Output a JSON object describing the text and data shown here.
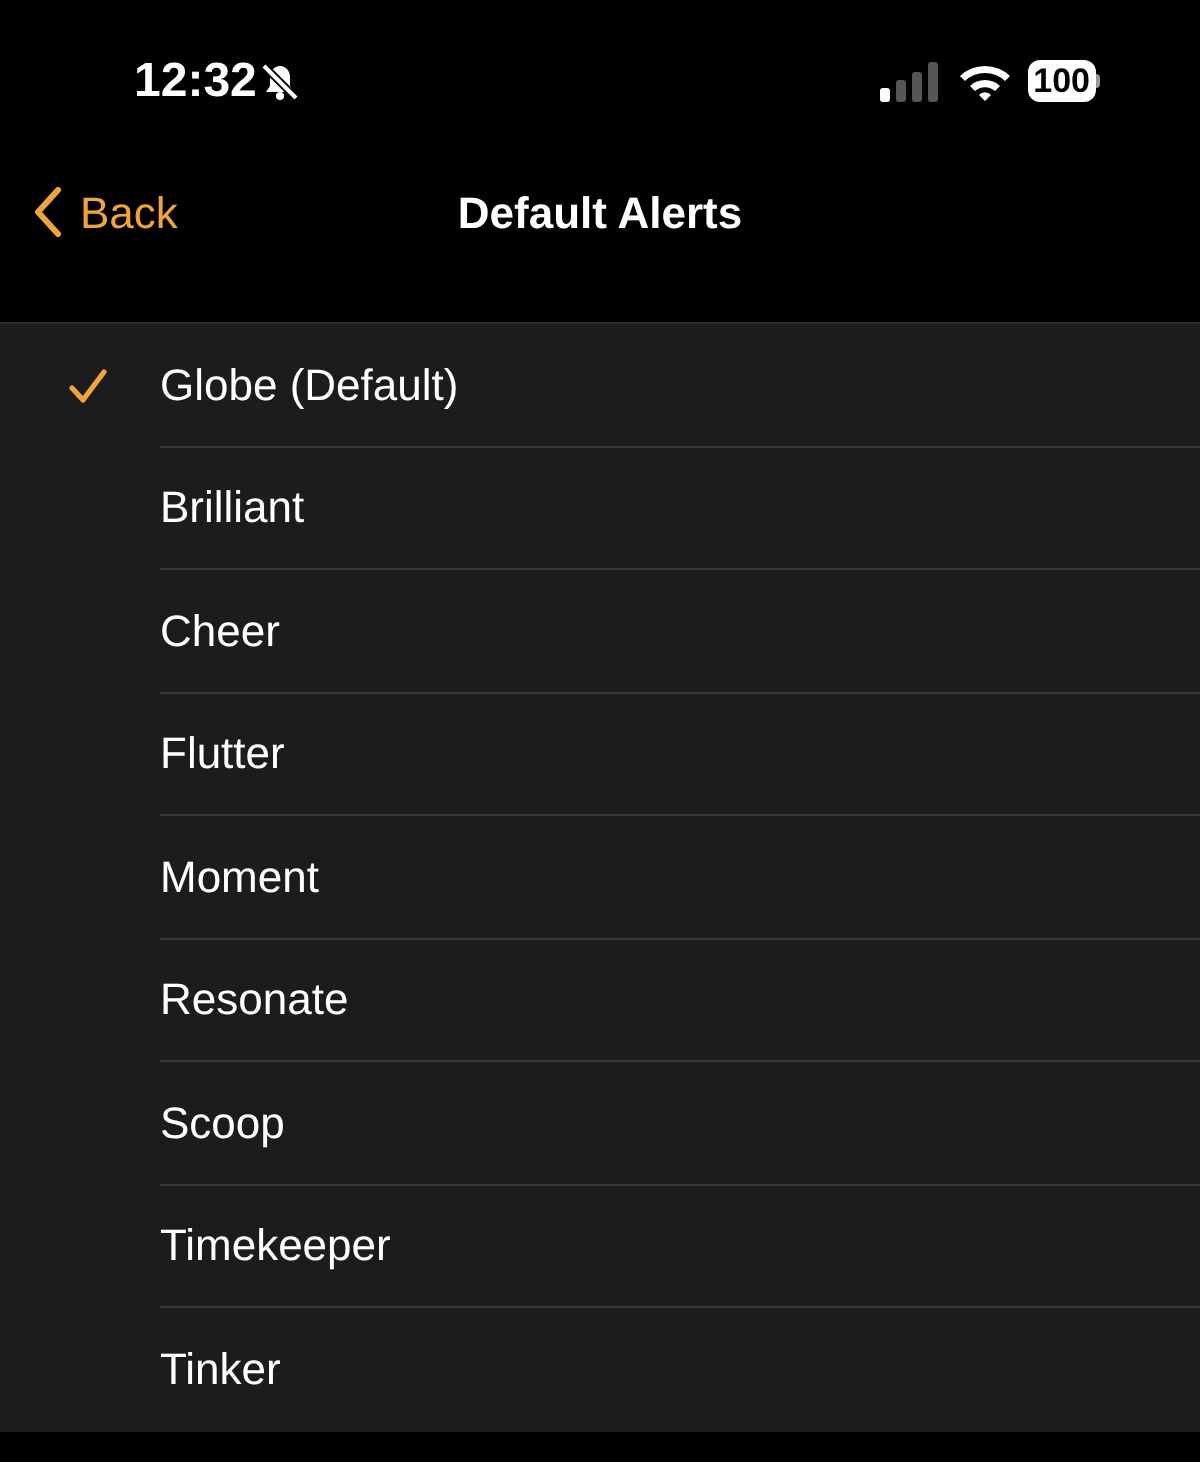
{
  "status_bar": {
    "time": "12:32",
    "battery": "100"
  },
  "nav": {
    "back": "Back",
    "title": "Default Alerts"
  },
  "items": [
    {
      "label": "Globe (Default)",
      "selected": true
    },
    {
      "label": "Brilliant",
      "selected": false
    },
    {
      "label": "Cheer",
      "selected": false
    },
    {
      "label": "Flutter",
      "selected": false
    },
    {
      "label": "Moment",
      "selected": false
    },
    {
      "label": "Resonate",
      "selected": false
    },
    {
      "label": "Scoop",
      "selected": false
    },
    {
      "label": "Timekeeper",
      "selected": false
    },
    {
      "label": "Tinker",
      "selected": false
    }
  ]
}
